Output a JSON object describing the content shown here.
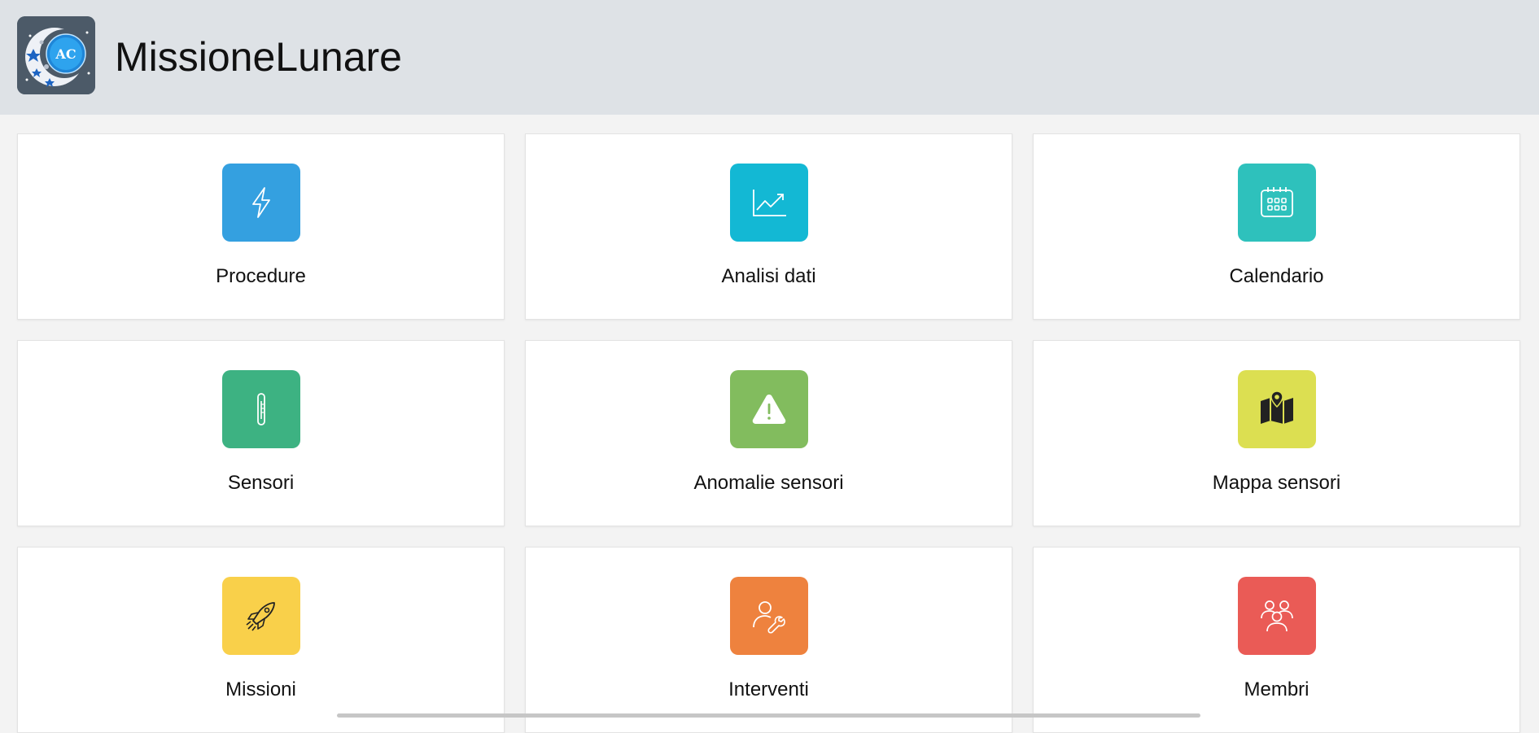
{
  "header": {
    "title": "MissioneLunare",
    "logo_text": "AC"
  },
  "cards": [
    {
      "label": "Procedure",
      "icon": "lightning-icon",
      "color": "#34a0e0"
    },
    {
      "label": "Analisi dati",
      "icon": "line-chart-icon",
      "color": "#13b8d4"
    },
    {
      "label": "Calendario",
      "icon": "calendar-icon",
      "color": "#2ec1bc"
    },
    {
      "label": "Sensori",
      "icon": "thermometer-icon",
      "color": "#3db282"
    },
    {
      "label": "Anomalie sensori",
      "icon": "warning-icon",
      "color": "#82bc5e"
    },
    {
      "label": "Mappa sensori",
      "icon": "map-pin-icon",
      "color": "#dcdf51"
    },
    {
      "label": "Missioni",
      "icon": "rocket-icon",
      "color": "#f9d04a"
    },
    {
      "label": "Interventi",
      "icon": "user-wrench-icon",
      "color": "#ee823e"
    },
    {
      "label": "Membri",
      "icon": "users-icon",
      "color": "#ea5b56"
    }
  ]
}
